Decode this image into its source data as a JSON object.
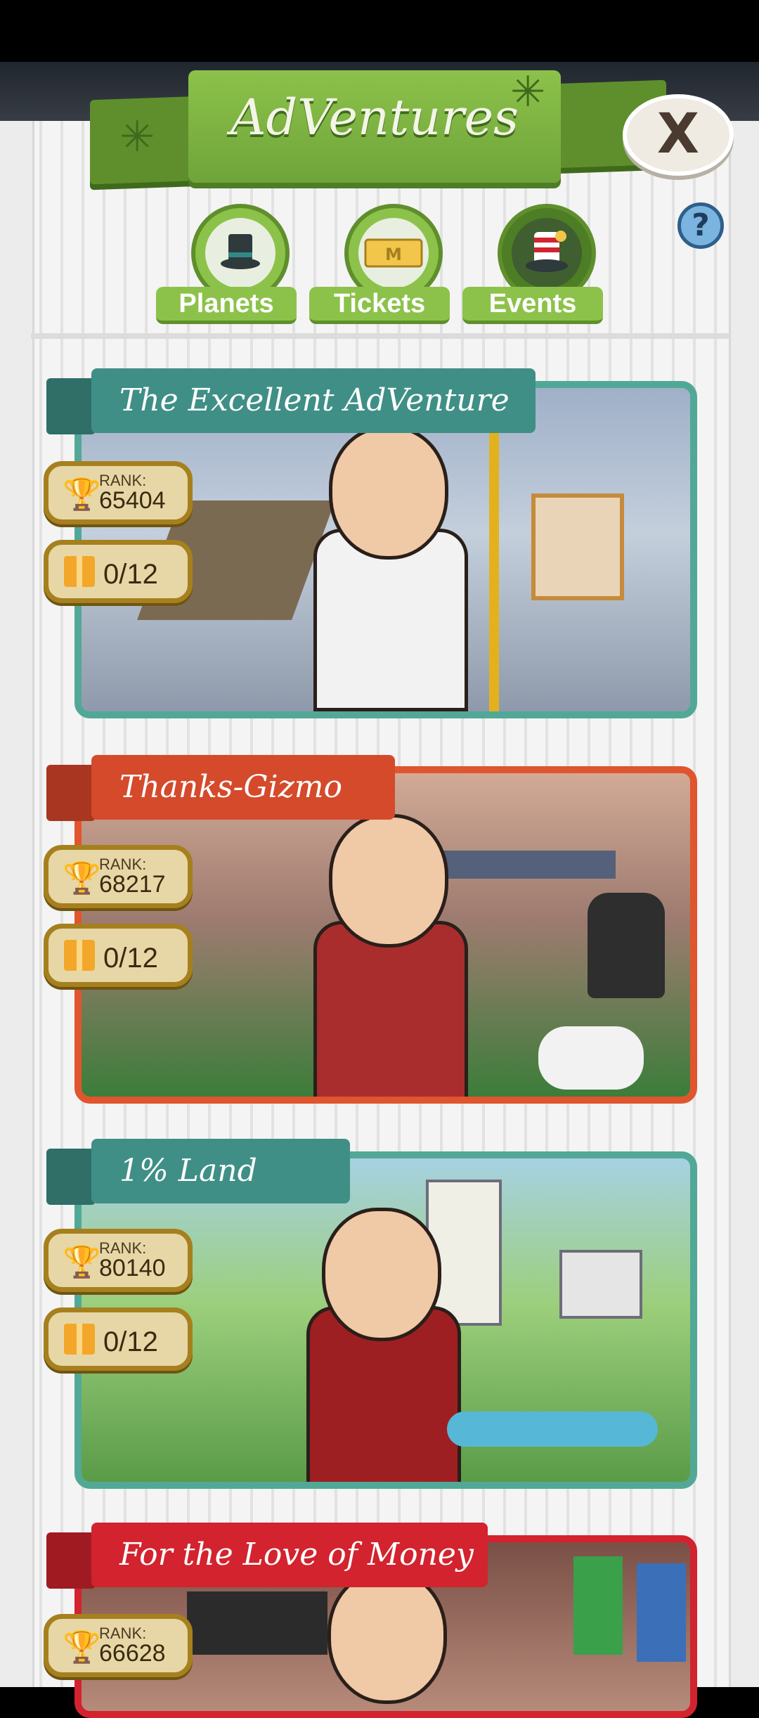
{
  "header": {
    "title": "AdVentures",
    "close_label": "X",
    "help_label": "?"
  },
  "tabs": [
    {
      "label": "Planets",
      "icon": "top-hat-icon"
    },
    {
      "label": "Tickets",
      "icon": "ticket-icon",
      "icon_text": "M"
    },
    {
      "label": "Events",
      "icon": "event-hat-icon"
    }
  ],
  "adventures": [
    {
      "title": "The Excellent AdVenture",
      "rank_label": "RANK:",
      "rank": "65404",
      "progress": "0/12",
      "color": "#3f8f86"
    },
    {
      "title": "Thanks-Gizmo",
      "rank_label": "RANK:",
      "rank": "68217",
      "progress": "0/12",
      "color": "#d44a2b"
    },
    {
      "title": "1% Land",
      "rank_label": "RANK:",
      "rank": "80140",
      "progress": "0/12",
      "color": "#3f8f86"
    },
    {
      "title": "For the Love of Money",
      "rank_label": "RANK:",
      "rank": "66628",
      "color": "#d2232e"
    }
  ]
}
